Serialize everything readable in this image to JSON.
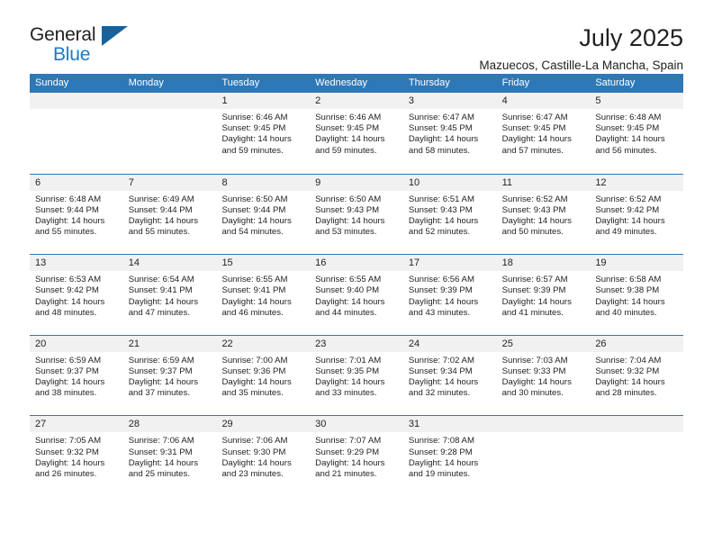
{
  "logo": {
    "primary": "General",
    "secondary": "Blue",
    "triangle_color": "#15629f"
  },
  "header": {
    "title": "July 2025",
    "subtitle": "Mazuecos, Castille-La Mancha, Spain"
  },
  "colors": {
    "header_blue": "#2e78b8",
    "daynum_band": "#f1f1f1",
    "text": "#231f20",
    "logo_blue": "#1d7ac4"
  },
  "weekdays": [
    "Sunday",
    "Monday",
    "Tuesday",
    "Wednesday",
    "Thursday",
    "Friday",
    "Saturday"
  ],
  "weeks": [
    [
      {
        "day": "",
        "sunrise": "",
        "sunset": "",
        "daylight_1": "",
        "daylight_2": ""
      },
      {
        "day": "",
        "sunrise": "",
        "sunset": "",
        "daylight_1": "",
        "daylight_2": ""
      },
      {
        "day": "1",
        "sunrise": "Sunrise: 6:46 AM",
        "sunset": "Sunset: 9:45 PM",
        "daylight_1": "Daylight: 14 hours",
        "daylight_2": "and 59 minutes."
      },
      {
        "day": "2",
        "sunrise": "Sunrise: 6:46 AM",
        "sunset": "Sunset: 9:45 PM",
        "daylight_1": "Daylight: 14 hours",
        "daylight_2": "and 59 minutes."
      },
      {
        "day": "3",
        "sunrise": "Sunrise: 6:47 AM",
        "sunset": "Sunset: 9:45 PM",
        "daylight_1": "Daylight: 14 hours",
        "daylight_2": "and 58 minutes."
      },
      {
        "day": "4",
        "sunrise": "Sunrise: 6:47 AM",
        "sunset": "Sunset: 9:45 PM",
        "daylight_1": "Daylight: 14 hours",
        "daylight_2": "and 57 minutes."
      },
      {
        "day": "5",
        "sunrise": "Sunrise: 6:48 AM",
        "sunset": "Sunset: 9:45 PM",
        "daylight_1": "Daylight: 14 hours",
        "daylight_2": "and 56 minutes."
      }
    ],
    [
      {
        "day": "6",
        "sunrise": "Sunrise: 6:48 AM",
        "sunset": "Sunset: 9:44 PM",
        "daylight_1": "Daylight: 14 hours",
        "daylight_2": "and 55 minutes."
      },
      {
        "day": "7",
        "sunrise": "Sunrise: 6:49 AM",
        "sunset": "Sunset: 9:44 PM",
        "daylight_1": "Daylight: 14 hours",
        "daylight_2": "and 55 minutes."
      },
      {
        "day": "8",
        "sunrise": "Sunrise: 6:50 AM",
        "sunset": "Sunset: 9:44 PM",
        "daylight_1": "Daylight: 14 hours",
        "daylight_2": "and 54 minutes."
      },
      {
        "day": "9",
        "sunrise": "Sunrise: 6:50 AM",
        "sunset": "Sunset: 9:43 PM",
        "daylight_1": "Daylight: 14 hours",
        "daylight_2": "and 53 minutes."
      },
      {
        "day": "10",
        "sunrise": "Sunrise: 6:51 AM",
        "sunset": "Sunset: 9:43 PM",
        "daylight_1": "Daylight: 14 hours",
        "daylight_2": "and 52 minutes."
      },
      {
        "day": "11",
        "sunrise": "Sunrise: 6:52 AM",
        "sunset": "Sunset: 9:43 PM",
        "daylight_1": "Daylight: 14 hours",
        "daylight_2": "and 50 minutes."
      },
      {
        "day": "12",
        "sunrise": "Sunrise: 6:52 AM",
        "sunset": "Sunset: 9:42 PM",
        "daylight_1": "Daylight: 14 hours",
        "daylight_2": "and 49 minutes."
      }
    ],
    [
      {
        "day": "13",
        "sunrise": "Sunrise: 6:53 AM",
        "sunset": "Sunset: 9:42 PM",
        "daylight_1": "Daylight: 14 hours",
        "daylight_2": "and 48 minutes."
      },
      {
        "day": "14",
        "sunrise": "Sunrise: 6:54 AM",
        "sunset": "Sunset: 9:41 PM",
        "daylight_1": "Daylight: 14 hours",
        "daylight_2": "and 47 minutes."
      },
      {
        "day": "15",
        "sunrise": "Sunrise: 6:55 AM",
        "sunset": "Sunset: 9:41 PM",
        "daylight_1": "Daylight: 14 hours",
        "daylight_2": "and 46 minutes."
      },
      {
        "day": "16",
        "sunrise": "Sunrise: 6:55 AM",
        "sunset": "Sunset: 9:40 PM",
        "daylight_1": "Daylight: 14 hours",
        "daylight_2": "and 44 minutes."
      },
      {
        "day": "17",
        "sunrise": "Sunrise: 6:56 AM",
        "sunset": "Sunset: 9:39 PM",
        "daylight_1": "Daylight: 14 hours",
        "daylight_2": "and 43 minutes."
      },
      {
        "day": "18",
        "sunrise": "Sunrise: 6:57 AM",
        "sunset": "Sunset: 9:39 PM",
        "daylight_1": "Daylight: 14 hours",
        "daylight_2": "and 41 minutes."
      },
      {
        "day": "19",
        "sunrise": "Sunrise: 6:58 AM",
        "sunset": "Sunset: 9:38 PM",
        "daylight_1": "Daylight: 14 hours",
        "daylight_2": "and 40 minutes."
      }
    ],
    [
      {
        "day": "20",
        "sunrise": "Sunrise: 6:59 AM",
        "sunset": "Sunset: 9:37 PM",
        "daylight_1": "Daylight: 14 hours",
        "daylight_2": "and 38 minutes."
      },
      {
        "day": "21",
        "sunrise": "Sunrise: 6:59 AM",
        "sunset": "Sunset: 9:37 PM",
        "daylight_1": "Daylight: 14 hours",
        "daylight_2": "and 37 minutes."
      },
      {
        "day": "22",
        "sunrise": "Sunrise: 7:00 AM",
        "sunset": "Sunset: 9:36 PM",
        "daylight_1": "Daylight: 14 hours",
        "daylight_2": "and 35 minutes."
      },
      {
        "day": "23",
        "sunrise": "Sunrise: 7:01 AM",
        "sunset": "Sunset: 9:35 PM",
        "daylight_1": "Daylight: 14 hours",
        "daylight_2": "and 33 minutes."
      },
      {
        "day": "24",
        "sunrise": "Sunrise: 7:02 AM",
        "sunset": "Sunset: 9:34 PM",
        "daylight_1": "Daylight: 14 hours",
        "daylight_2": "and 32 minutes."
      },
      {
        "day": "25",
        "sunrise": "Sunrise: 7:03 AM",
        "sunset": "Sunset: 9:33 PM",
        "daylight_1": "Daylight: 14 hours",
        "daylight_2": "and 30 minutes."
      },
      {
        "day": "26",
        "sunrise": "Sunrise: 7:04 AM",
        "sunset": "Sunset: 9:32 PM",
        "daylight_1": "Daylight: 14 hours",
        "daylight_2": "and 28 minutes."
      }
    ],
    [
      {
        "day": "27",
        "sunrise": "Sunrise: 7:05 AM",
        "sunset": "Sunset: 9:32 PM",
        "daylight_1": "Daylight: 14 hours",
        "daylight_2": "and 26 minutes."
      },
      {
        "day": "28",
        "sunrise": "Sunrise: 7:06 AM",
        "sunset": "Sunset: 9:31 PM",
        "daylight_1": "Daylight: 14 hours",
        "daylight_2": "and 25 minutes."
      },
      {
        "day": "29",
        "sunrise": "Sunrise: 7:06 AM",
        "sunset": "Sunset: 9:30 PM",
        "daylight_1": "Daylight: 14 hours",
        "daylight_2": "and 23 minutes."
      },
      {
        "day": "30",
        "sunrise": "Sunrise: 7:07 AM",
        "sunset": "Sunset: 9:29 PM",
        "daylight_1": "Daylight: 14 hours",
        "daylight_2": "and 21 minutes."
      },
      {
        "day": "31",
        "sunrise": "Sunrise: 7:08 AM",
        "sunset": "Sunset: 9:28 PM",
        "daylight_1": "Daylight: 14 hours",
        "daylight_2": "and 19 minutes."
      },
      {
        "day": "",
        "sunrise": "",
        "sunset": "",
        "daylight_1": "",
        "daylight_2": ""
      },
      {
        "day": "",
        "sunrise": "",
        "sunset": "",
        "daylight_1": "",
        "daylight_2": ""
      }
    ]
  ]
}
